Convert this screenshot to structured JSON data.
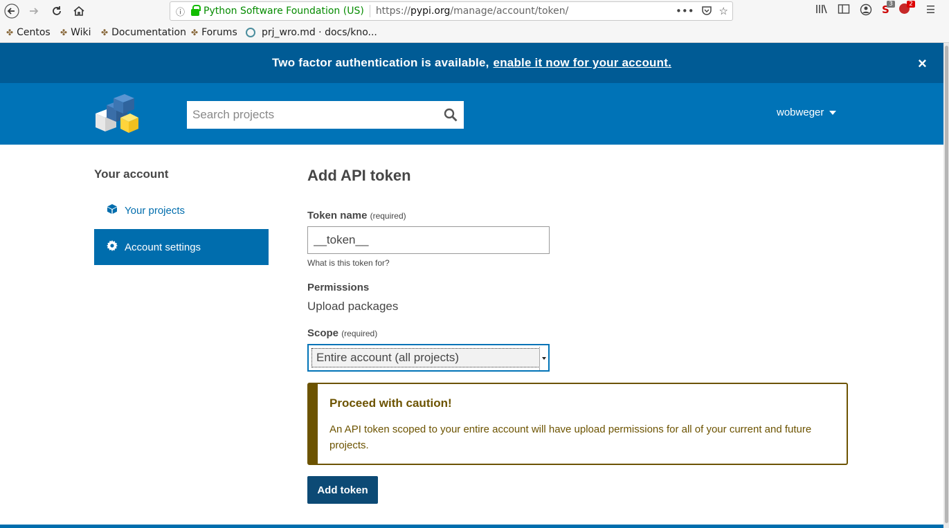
{
  "browser": {
    "url_org": "Python Software Foundation (US)",
    "url_prefix": "https://",
    "url_host": "pypi.org",
    "url_path": "/manage/account/token/",
    "badge_s": "3",
    "badge_r": "2"
  },
  "bookmarks": [
    {
      "label": "Centos"
    },
    {
      "label": "Wiki"
    },
    {
      "label": "Documentation"
    },
    {
      "label": "Forums"
    },
    {
      "label": "prj_wro.md · docs/kno..."
    }
  ],
  "notice": {
    "text": "Two factor authentication is available,",
    "link": "enable it now for your account.",
    "close": "×"
  },
  "header": {
    "search_placeholder": "Search projects",
    "username": "wobweger"
  },
  "sidebar": {
    "title": "Your account",
    "items": [
      {
        "label": "Your projects",
        "icon": "cube-icon"
      },
      {
        "label": "Account settings",
        "icon": "gear-icon"
      }
    ]
  },
  "form": {
    "title": "Add API token",
    "token_name_label": "Token name",
    "required": "(required)",
    "token_name_value": "__token__",
    "token_help": "What is this token for?",
    "permissions_label": "Permissions",
    "permissions_value": "Upload packages",
    "scope_label": "Scope",
    "scope_value": "Entire account (all projects)",
    "caution_title": "Proceed with caution!",
    "caution_text": "An API token scoped to your entire account will have upload permissions for all of your current and future projects.",
    "submit_label": "Add token"
  },
  "colors": {
    "notice_bg": "#005b95",
    "header_bg": "#0073b7",
    "active_side": "#006dad",
    "caution": "#6c5300",
    "button": "#0c4a75"
  }
}
